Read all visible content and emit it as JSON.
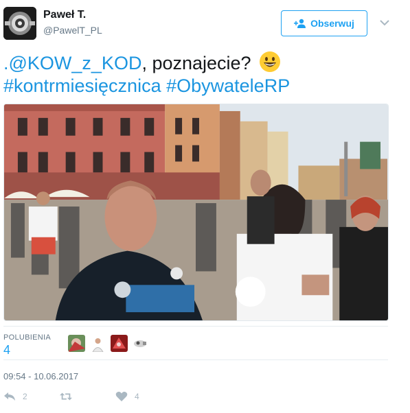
{
  "user": {
    "display_name": "Paweł T.",
    "handle": "@PawelT_PL",
    "avatar_icon": "gear-avatar-icon"
  },
  "follow_button": {
    "label": "Obserwuj",
    "icon": "add-user-icon"
  },
  "tweet": {
    "mention": ".@KOW_z_KOD",
    "text_after_mention": ", poznajecie?",
    "emoji": "grinning-face-emoji",
    "hashtag_1": "#kontrmiesięcznica",
    "hashtag_2": "#ObywateleRP"
  },
  "stats": {
    "likes_label": "POLUBIENIA",
    "likes_count": "4"
  },
  "timestamp": "09:54 - 10.06.2017",
  "actions": {
    "reply_count": "2",
    "retweet_count": "",
    "like_count": "4"
  },
  "colors": {
    "link": "#1b95e0",
    "accent": "#1da1f2",
    "muted": "#657786"
  }
}
